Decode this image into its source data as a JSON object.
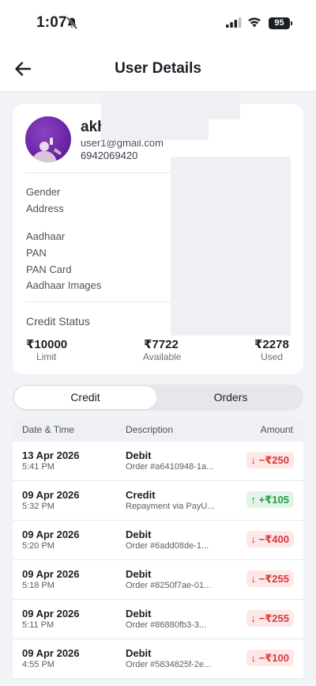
{
  "status_bar": {
    "time": "1:07",
    "battery": "95"
  },
  "header": {
    "title": "User Details"
  },
  "profile": {
    "name": "akh",
    "email": "user1@gmail.com",
    "phone": "6942069420",
    "fields": [
      "Gender",
      "Address",
      "Aadhaar",
      "PAN",
      "PAN Card",
      "Aadhaar Images"
    ],
    "credit_status_label": "Credit Status",
    "limit": {
      "value": "₹10000",
      "label": "Limit"
    },
    "available": {
      "value": "₹7722",
      "label": "Available"
    },
    "used": {
      "value": "₹2278",
      "label": "Used"
    }
  },
  "tabs": {
    "credit": "Credit",
    "orders": "Orders",
    "active": "Credit"
  },
  "table": {
    "headers": {
      "date": "Date & Time",
      "description": "Description",
      "amount": "Amount"
    },
    "rows": [
      {
        "date": "13 Apr 2026",
        "time": "5:41 PM",
        "type": "Debit",
        "desc": "Order #a6410948-1a...",
        "amount": "↓ −₹250",
        "kind": "debit"
      },
      {
        "date": "09 Apr 2026",
        "time": "5:32 PM",
        "type": "Credit",
        "desc": "Repayment via PayU...",
        "amount": "↑ +₹105",
        "kind": "credit"
      },
      {
        "date": "09 Apr 2026",
        "time": "5:20 PM",
        "type": "Debit",
        "desc": "Order #6add08de-1...",
        "amount": "↓ −₹400",
        "kind": "debit"
      },
      {
        "date": "09 Apr 2026",
        "time": "5:18 PM",
        "type": "Debit",
        "desc": "Order #8250f7ae-01...",
        "amount": "↓ −₹255",
        "kind": "debit"
      },
      {
        "date": "09 Apr 2026",
        "time": "5:11 PM",
        "type": "Debit",
        "desc": "Order #86880fb3-3...",
        "amount": "↓ −₹255",
        "kind": "debit"
      },
      {
        "date": "09 Apr 2026",
        "time": "4:55 PM",
        "type": "Debit",
        "desc": "Order #5834825f-2e...",
        "amount": "↓ −₹100",
        "kind": "debit"
      }
    ]
  },
  "colors": {
    "debit": "#d63a3a",
    "credit": "#1f9b47",
    "accent_avatar": "#7a2fb8"
  }
}
